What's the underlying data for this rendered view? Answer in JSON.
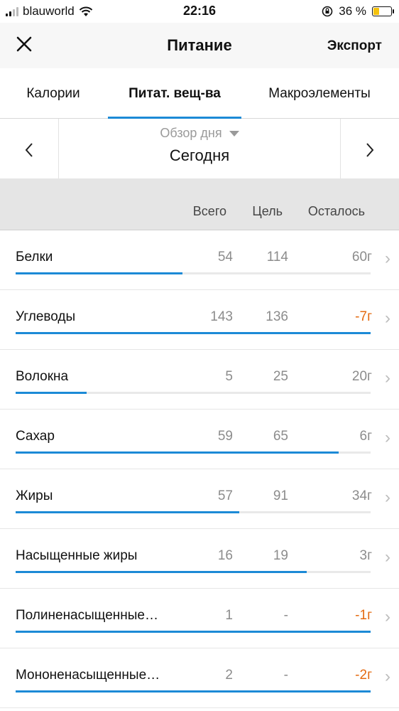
{
  "status": {
    "carrier": "blauworld",
    "time": "22:16",
    "battery_text": "36 %",
    "battery_level": 0.36
  },
  "navbar": {
    "title": "Питание",
    "export_label": "Экспорт"
  },
  "tabs": [
    {
      "label": "Калории",
      "active": false
    },
    {
      "label": "Питат. вещ-ва",
      "active": true
    },
    {
      "label": "Макроэлементы",
      "active": false
    }
  ],
  "date": {
    "mode": "Обзор дня",
    "day": "Сегодня"
  },
  "columns": {
    "total": "Всего",
    "goal": "Цель",
    "left": "Осталось"
  },
  "colors": {
    "accent": "#1c8ad6",
    "over": "#e46b12"
  },
  "rows": [
    {
      "name": "Белки",
      "total": "54",
      "goal": "114",
      "left": "60г",
      "over": false,
      "progress": 0.47
    },
    {
      "name": "Углеводы",
      "total": "143",
      "goal": "136",
      "left": "-7г",
      "over": true,
      "progress": 1.0
    },
    {
      "name": "Волокна",
      "total": "5",
      "goal": "25",
      "left": "20г",
      "over": false,
      "progress": 0.2
    },
    {
      "name": "Сахар",
      "total": "59",
      "goal": "65",
      "left": "6г",
      "over": false,
      "progress": 0.91
    },
    {
      "name": "Жиры",
      "total": "57",
      "goal": "91",
      "left": "34г",
      "over": false,
      "progress": 0.63
    },
    {
      "name": "Насыщенные жиры",
      "total": "16",
      "goal": "19",
      "left": "3г",
      "over": false,
      "progress": 0.82
    },
    {
      "name": "Полиненасыщенные…",
      "total": "1",
      "goal": "-",
      "left": "-1г",
      "over": true,
      "progress": 1.0
    },
    {
      "name": "Мононенасыщенные…",
      "total": "2",
      "goal": "-",
      "left": "-2г",
      "over": true,
      "progress": 1.0
    }
  ]
}
